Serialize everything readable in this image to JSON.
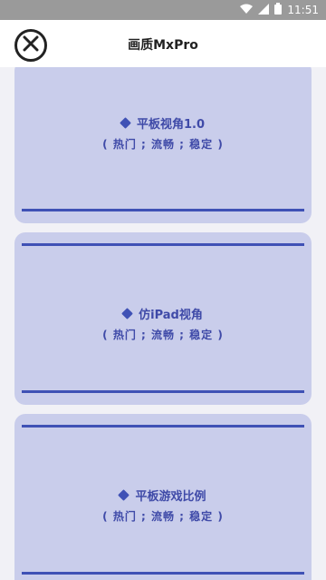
{
  "status_bar": {
    "time": "11:51"
  },
  "header": {
    "title": "画质MxPro"
  },
  "cards": [
    {
      "title": "平板视角1.0",
      "tags": "( 热门 ; 流畅 ; 稳定 )"
    },
    {
      "title": "仿iPad视角",
      "tags": "( 热门 ; 流畅 ; 稳定 )"
    },
    {
      "title": "平板游戏比例",
      "tags": "( 热门 ; 流畅 ; 稳定 )"
    }
  ],
  "colors": {
    "accent": "#3f51b5",
    "card_bg": "#c9cdeb",
    "content_bg": "#f1f1f6"
  }
}
